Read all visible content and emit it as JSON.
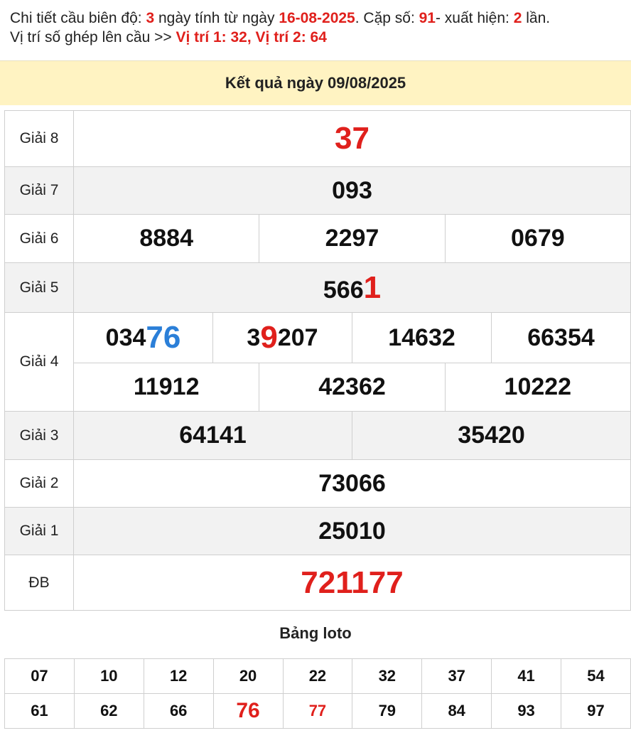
{
  "info": {
    "l1_a": "Chi tiết cầu biên độ: ",
    "l1_days": "3",
    "l1_b": " ngày tính từ ngày ",
    "l1_date": "16-08-2025",
    "l1_c": ". Cặp số: ",
    "l1_pair": "91",
    "l1_d": "- xuất hiện: ",
    "l1_count": "2",
    "l1_e": " lần.",
    "l2_a": "Vị trí số ghép lên cầu >> ",
    "l2_pos": "Vị trí 1: 32, Vị trí 2: 64"
  },
  "banner": {
    "title": "Kết quả ngày 09/08/2025"
  },
  "results": {
    "g8": {
      "label": "Giải 8",
      "value": "37"
    },
    "g7": {
      "label": "Giải 7",
      "value": "093"
    },
    "g6": {
      "label": "Giải 6",
      "values": [
        "8884",
        "2297",
        "0679"
      ]
    },
    "g5": {
      "label": "Giải 5",
      "value_a": "566",
      "value_b": "1"
    },
    "g4": {
      "label": "Giải 4",
      "v1_a": "034",
      "v1_b": "76",
      "v2_a": "3",
      "v2_b": "9",
      "v2_c": "207",
      "v3": "14632",
      "v4": "66354",
      "v5": "11912",
      "v6": "42362",
      "v7": "10222"
    },
    "g3": {
      "label": "Giải 3",
      "values": [
        "64141",
        "35420"
      ]
    },
    "g2": {
      "label": "Giải 2",
      "value": "73066"
    },
    "g1": {
      "label": "Giải 1",
      "value": "25010"
    },
    "db": {
      "label": "ĐB",
      "value": "721177"
    }
  },
  "loto": {
    "title": "Bảng loto",
    "row1": [
      "07",
      "10",
      "12",
      "20",
      "22",
      "32",
      "37",
      "41",
      "54"
    ],
    "row2": [
      "61",
      "62",
      "66",
      "76",
      "77",
      "79",
      "84",
      "93",
      "97"
    ],
    "highlight_color": "#e0201c"
  }
}
